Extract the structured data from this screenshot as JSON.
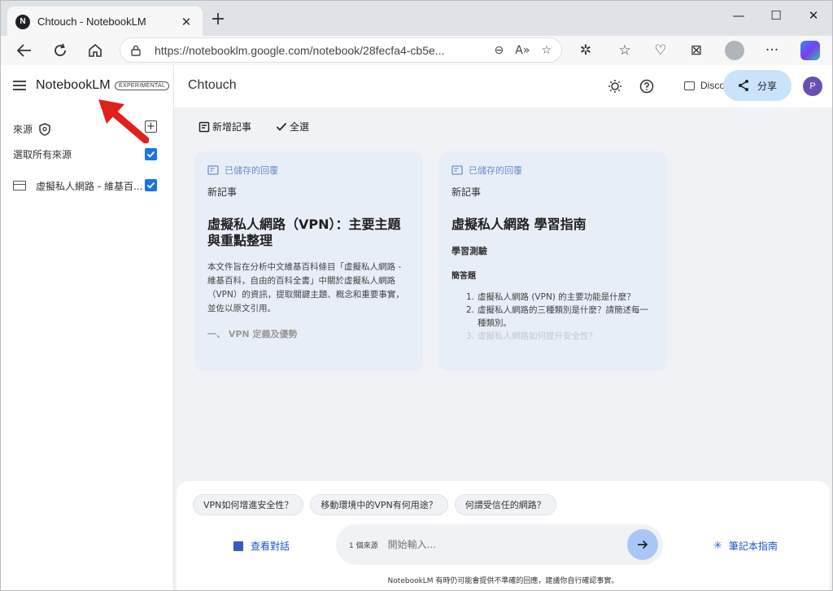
{
  "browser": {
    "tab_title": "Chtouch - NotebookLM",
    "tab_favicon": "N",
    "url": "https://notebooklm.google.com/notebook/28fecfa4-cb5e..."
  },
  "sidebar": {
    "brand": "NotebookLM",
    "badge": "EXPERIMENTAL",
    "sources_label": "來源",
    "select_all_label": "選取所有來源",
    "sources": [
      {
        "label": "虛擬私人網路 - 維基百...",
        "checked": true
      }
    ]
  },
  "header": {
    "notebook_title": "Chtouch",
    "discord_label": "Discord",
    "share_label": "分享",
    "user_initial": "P"
  },
  "actions": {
    "add_note": "新增記事",
    "select_all": "全選"
  },
  "notes": [
    {
      "tag": "已儲存的回覆",
      "subtitle": "新記事",
      "heading": "虛擬私人網路（VPN）：主要主題與重點整理",
      "body": "本文件旨在分析中文維基百科條目「虛擬私人網路 - 維基百科，自由的百科全書」中關於虛擬私人網路（VPN）的資訊，提取關鍵主題、概念和重要事實，並佐以原文引用。",
      "fade": "一、 VPN 定義及優勢"
    },
    {
      "tag": "已儲存的回覆",
      "subtitle": "新記事",
      "heading": "虛擬私人網路 學習指南",
      "section": "學習測驗",
      "subsection": "簡答題",
      "items": [
        "虛擬私人網路 (VPN) 的主要功能是什麼？",
        "虛擬私人網路的三種類別是什麼？請簡述每一種類別。",
        "虛擬私人網路如何提升安全性？"
      ]
    }
  ],
  "chat": {
    "suggestions": [
      "VPN如何增進安全性？",
      "移動環境中的VPN有何用途？",
      "何謂受信任的網路？"
    ],
    "view_chat": "查看對話",
    "source_count": "1 個來源",
    "placeholder": "開始輸入...",
    "notebook_guide": "筆記本指南",
    "disclaimer": "NotebookLM 有時仍可能會提供不準確的回應，建議你自行確認事實。"
  },
  "colors": {
    "accent": "#1a73e8",
    "annotation_arrow": "#e0211b",
    "card_bg": "#e8eef7",
    "share_bg": "#c9e3fb"
  }
}
